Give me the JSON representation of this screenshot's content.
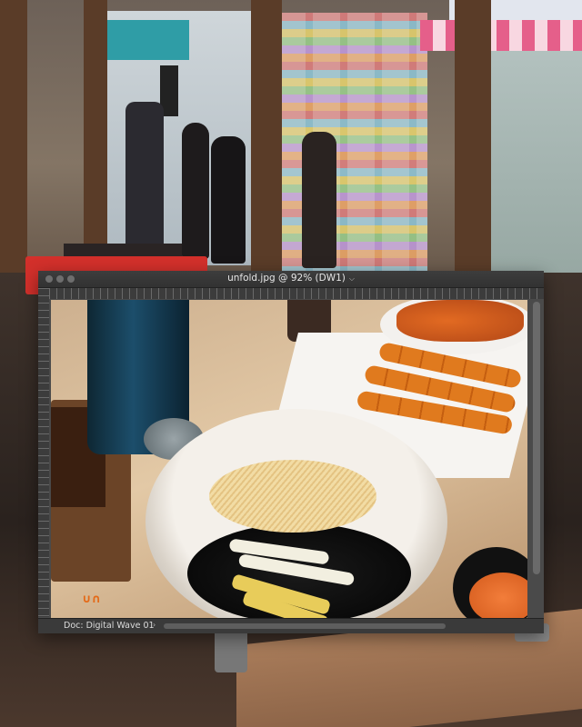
{
  "window": {
    "title": "unfold.jpg @ 92% (DW1)",
    "title_chevron": "⌵",
    "controls": [
      "close",
      "minimize",
      "zoom"
    ]
  },
  "canvas": {
    "overlay_glyph": "∪∩"
  },
  "status": {
    "doc_info": "Doc: Digital Wave 01",
    "menu_chevron": "›"
  },
  "icons": {
    "traffic": "dot",
    "disclosure": "chevron"
  },
  "colors": {
    "window_bg": "#4a4a4a",
    "titlebar": "#353535",
    "title_text": "#e6e6e6",
    "accent_orange": "#e46a18"
  }
}
